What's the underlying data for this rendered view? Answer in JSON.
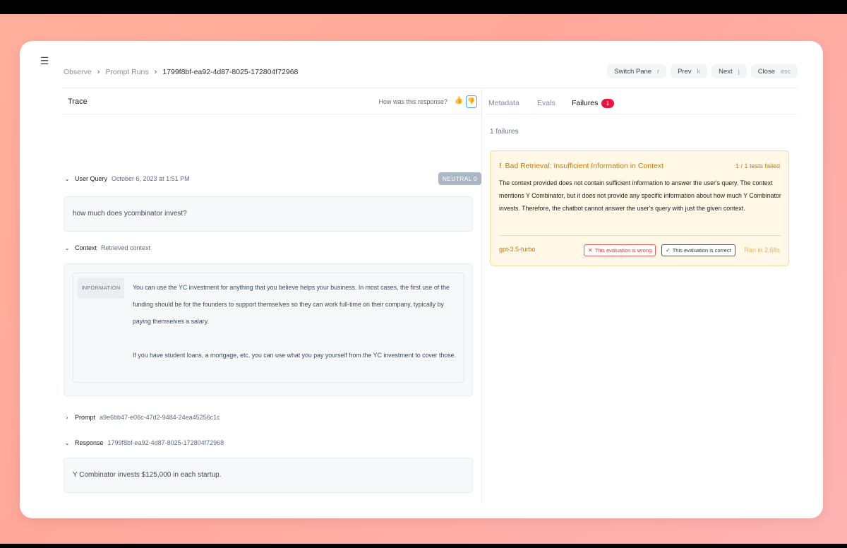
{
  "breadcrumb": {
    "items": [
      "Observe",
      "Prompt Runs"
    ],
    "current": "1799f8bf-ea92-4d87-8025-172804f72968"
  },
  "top_actions": [
    {
      "label": "Switch Pane",
      "key": "r"
    },
    {
      "label": "Prev",
      "key": "k"
    },
    {
      "label": "Next",
      "key": "j"
    },
    {
      "label": "Close",
      "key": "esc"
    }
  ],
  "trace": {
    "title": "Trace",
    "rate_prompt": "How was this response?"
  },
  "user_query": {
    "label": "User Query",
    "timestamp": "October 6, 2023 at 1:51 PM",
    "badge": "NEUTRAL 0",
    "text": "how much does ycombinator invest?"
  },
  "context": {
    "label": "Context",
    "subtitle": "Retrieved context",
    "tag": "INFORMATION",
    "paragraphs": [
      "You can use the YC investment for anything that you believe helps your business. In most cases, the first use of the funding should be for the founders to support themselves so they can work full-time on their company, typically by paying themselves a salary.",
      "If you have student loans, a mortgage, etc. you can use what you pay yourself from the YC investment to cover those."
    ]
  },
  "prompt": {
    "label": "Prompt",
    "id": "a9e6bb47-e06c-47d2-9484-24ea45256c1c"
  },
  "response": {
    "label": "Response",
    "id": "1799f8bf-ea92-4d87-8025-172804f72968",
    "text": "Y Combinator invests $125,000 in each startup."
  },
  "tabs": [
    {
      "label": "Metadata"
    },
    {
      "label": "Evals"
    },
    {
      "label": "Failures"
    }
  ],
  "failures": {
    "count_badge": "1",
    "summary": "1 failures",
    "card": {
      "title": "Bad Retrieval: Insufficient Information in Context",
      "tests": "1 / 1 tests failed",
      "description": "The context provided does not contain sufficient information to answer the user's query. The context mentions Y Combinator, but it does not provide any specific information about how much Y Combinator invests. Therefore, the chatbot cannot answer the user's query with just the given context.",
      "model": "gpt-3.5-turbo",
      "wrong_label": "This evaluation is wrong",
      "correct_label": "This evaluation is correct",
      "ran": "Ran in 2.68s"
    }
  },
  "icons": {
    "menu": "hamburger-icon",
    "thumb_up": "thumbs-up-icon",
    "thumb_down": "thumbs-down-icon"
  }
}
